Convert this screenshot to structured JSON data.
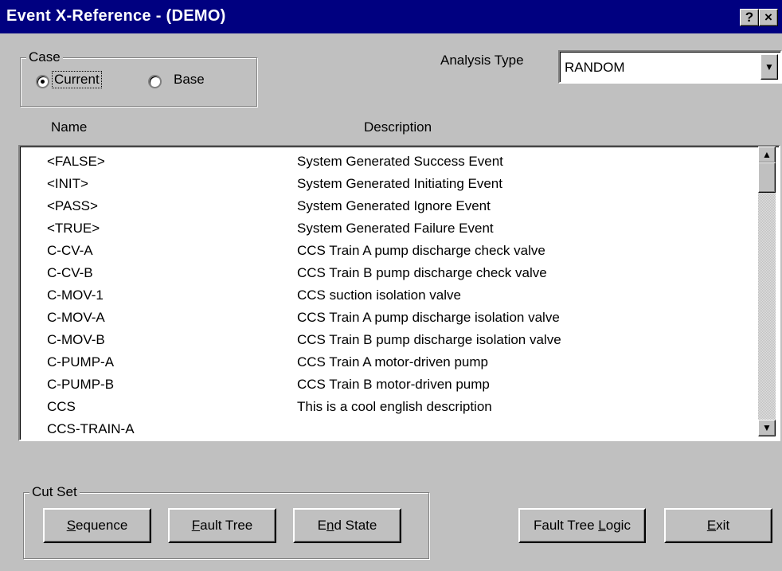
{
  "window": {
    "title": "Event X-Reference  -  (DEMO)",
    "help_glyph": "?",
    "close_glyph": "×"
  },
  "case": {
    "label": "Case",
    "options": [
      {
        "label": "Current",
        "selected": true
      },
      {
        "label": "Base",
        "selected": false
      }
    ]
  },
  "analysis": {
    "label": "Analysis Type",
    "value": "RANDOM"
  },
  "columns": {
    "name": "Name",
    "description": "Description"
  },
  "events": [
    {
      "name": "<FALSE>",
      "description": "System Generated Success Event"
    },
    {
      "name": "<INIT>",
      "description": "System Generated Initiating Event"
    },
    {
      "name": "<PASS>",
      "description": "System Generated Ignore Event"
    },
    {
      "name": "<TRUE>",
      "description": "System Generated Failure Event"
    },
    {
      "name": "C-CV-A",
      "description": "CCS Train A pump discharge check valve"
    },
    {
      "name": "C-CV-B",
      "description": "CCS Train B pump discharge check valve"
    },
    {
      "name": "C-MOV-1",
      "description": "CCS suction isolation valve"
    },
    {
      "name": "C-MOV-A",
      "description": "CCS Train A pump discharge isolation valve"
    },
    {
      "name": "C-MOV-B",
      "description": "CCS Train B pump discharge isolation valve"
    },
    {
      "name": "C-PUMP-A",
      "description": "CCS Train A motor-driven pump"
    },
    {
      "name": "C-PUMP-B",
      "description": "CCS Train B motor-driven pump"
    },
    {
      "name": "CCS",
      "description": "This is a cool english description"
    },
    {
      "name": "CCS-TRAIN-A",
      "description": ""
    }
  ],
  "cutset": {
    "label": "Cut Set",
    "sequence": {
      "u": "S",
      "rest": "equence"
    },
    "fault_tree": {
      "u": "F",
      "rest": "ault Tree"
    },
    "end_state": {
      "pre": "E",
      "u": "n",
      "rest": "d State"
    }
  },
  "fault_tree_logic": {
    "pre": "Fault Tree ",
    "u": "L",
    "rest": "ogic"
  },
  "exit": {
    "u": "E",
    "rest": "xit"
  },
  "icons": {
    "dropdown": "▼",
    "scroll_up": "▲",
    "scroll_down": "▼"
  }
}
